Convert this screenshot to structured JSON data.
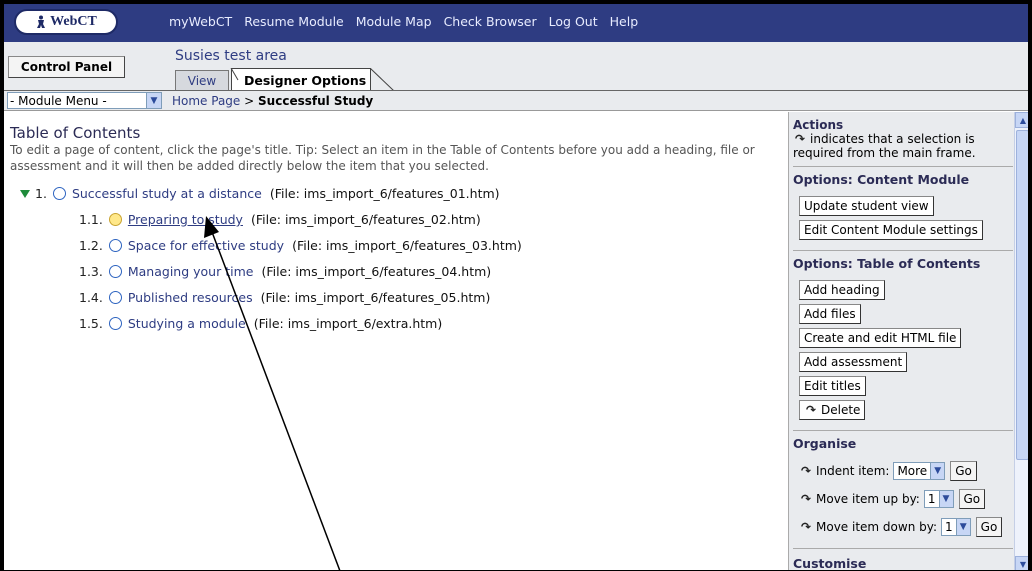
{
  "nav": {
    "logo": "WebCT",
    "links": [
      "myWebCT",
      "Resume Module",
      "Module Map",
      "Check Browser",
      "Log Out",
      "Help"
    ]
  },
  "header": {
    "control_panel": "Control Panel",
    "area_title": "Susies test area",
    "tab_view": "View",
    "tab_designer": "Designer Options"
  },
  "crumbs": {
    "module_menu": "- Module Menu -",
    "home": "Home Page",
    "separator": ">",
    "current": "Successful Study"
  },
  "toc": {
    "title": "Table of Contents",
    "help": "To edit a page of content, click the page's title. Tip: Select an item in the Table of Contents before you add a heading, file or assessment and it will then be added directly below the item that you selected.",
    "items": [
      {
        "num": "1.",
        "title": "Successful study at a distance",
        "file": "(File: ims_import_6/features_01.htm)"
      },
      {
        "num": "1.1.",
        "title": "Preparing to study",
        "file": "(File: ims_import_6/features_02.htm)"
      },
      {
        "num": "1.2.",
        "title": "Space for effective study",
        "file": "(File: ims_import_6/features_03.htm)"
      },
      {
        "num": "1.3.",
        "title": "Managing your time",
        "file": "(File: ims_import_6/features_04.htm)"
      },
      {
        "num": "1.4.",
        "title": "Published resources",
        "file": "(File: ims_import_6/features_05.htm)"
      },
      {
        "num": "1.5.",
        "title": "Studying a module",
        "file": "(File: ims_import_6/extra.htm)"
      }
    ]
  },
  "side": {
    "actions_title": "Actions",
    "actions_note": "indicates that a selection is required from the main frame.",
    "content_module_title": "Options: Content Module",
    "update_student_view": "Update student view",
    "edit_settings": "Edit Content Module settings",
    "toc_options_title": "Options: Table of Contents",
    "add_heading": "Add heading",
    "add_files": "Add files",
    "create_html": "Create and edit HTML file",
    "add_assessment": "Add assessment",
    "edit_titles": "Edit titles",
    "delete": "Delete",
    "organise_title": "Organise",
    "indent_label": "Indent item:",
    "indent_value": "More",
    "move_up_label": "Move item up by:",
    "move_up_value": "1",
    "move_down_label": "Move item down by:",
    "move_down_value": "1",
    "go": "Go",
    "customise_title": "Customise"
  },
  "colors": {
    "nav_bg": "#2e3c82",
    "panel_bg": "#e9ebee",
    "link": "#2e3c82"
  }
}
